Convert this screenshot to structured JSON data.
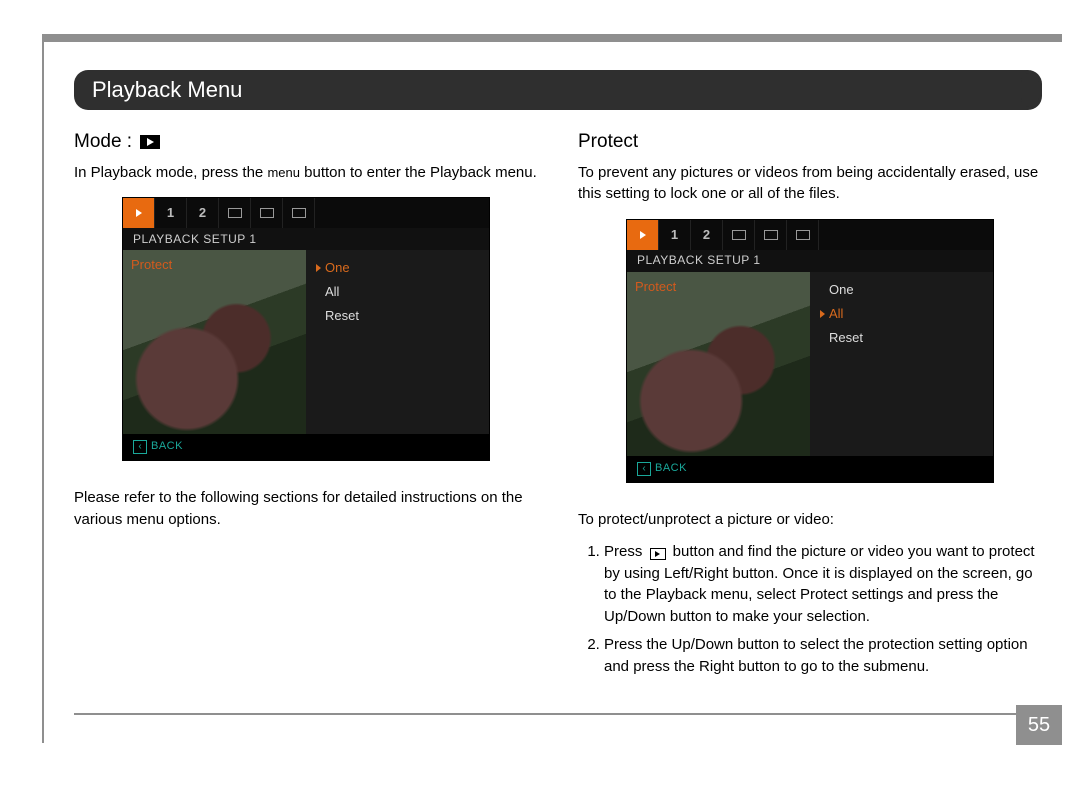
{
  "page": {
    "title": "Playback Menu",
    "number": "55"
  },
  "left": {
    "heading": "Mode :",
    "intro_a": "In Playback mode, press the ",
    "intro_menu": "menu",
    "intro_b": " button to enter the Playback menu.",
    "note": "Please refer to the following sections for detailed instructions on the various menu options."
  },
  "right": {
    "heading": "Protect",
    "intro": "To prevent any pictures or videos from being accidentally erased, use this setting to lock one or all of the files.",
    "steps_lead": "To protect/unprotect a picture or video:",
    "steps": [
      {
        "a": "Press ",
        "b": " button and find the picture or video you want to protect by using Left/Right button.  Once it is displayed on the screen, go to the Playback menu, select Protect settings and press the Up/Down button to make your selection."
      },
      {
        "text": "Press the Up/Down button to select the protection setting option and press the Right button to go to the submenu."
      }
    ]
  },
  "screens": {
    "tabs": [
      "1",
      "2"
    ],
    "header": "PLAYBACK  SETUP  1",
    "left_label": "Protect",
    "options": [
      "One",
      "All",
      "Reset"
    ],
    "back": "BACK"
  },
  "screen_left_selected": 0,
  "screen_right_selected": 1
}
